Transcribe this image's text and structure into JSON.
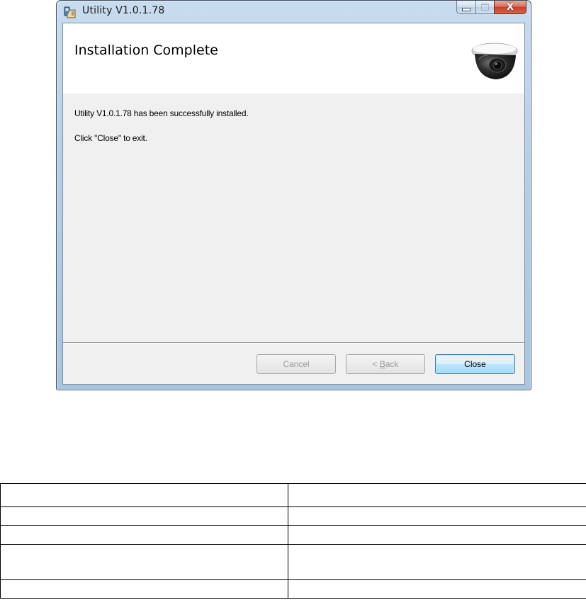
{
  "window": {
    "title": "Utility V1.0.1.78",
    "icon": "installer-icon",
    "controls": {
      "minimize_icon": "minimize-icon",
      "maximize_icon": "maximize-icon",
      "close_icon": "close-icon",
      "close_glyph": "X"
    }
  },
  "banner": {
    "title": "Installation Complete",
    "image": "dome-camera-image"
  },
  "content": {
    "line1": "Utility V1.0.1.78 has been successfully installed.",
    "line2": "Click \"Close\" to exit."
  },
  "buttons": {
    "cancel_label": "Cancel",
    "back_prefix": "< ",
    "back_accel": "B",
    "back_suffix": "ack",
    "close_label": "Close"
  },
  "colors": {
    "titlebar": "#b7cfe8",
    "close_button": "#c4412a",
    "default_button_border": "#3c7fb1",
    "dialog_background": "#f0f0f0"
  },
  "table": {
    "rows": [
      [
        "",
        ""
      ],
      [
        "",
        ""
      ],
      [
        "",
        ""
      ],
      [
        "",
        ""
      ],
      [
        "",
        ""
      ]
    ]
  }
}
